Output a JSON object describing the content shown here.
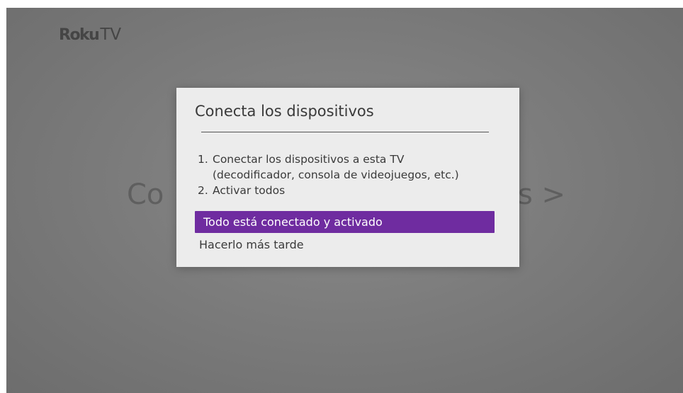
{
  "brand": {
    "roku": "Roku",
    "tv": "TV"
  },
  "background": {
    "left_text": "Co",
    "right_text": "s >"
  },
  "dialog": {
    "title": "Conecta los dispositivos",
    "steps": [
      {
        "num": "1.",
        "lines": [
          "Conectar los dispositivos a esta TV",
          "(decodificador, consola de videojuegos, etc.)"
        ]
      },
      {
        "num": "2.",
        "lines": [
          "Activar todos"
        ]
      }
    ],
    "options": [
      {
        "label": "Todo está conectado y activado",
        "selected": true
      },
      {
        "label": "Hacerlo más tarde",
        "selected": false
      }
    ]
  },
  "colors": {
    "accent": "#6f2ca0",
    "dialog_bg": "#ececec",
    "screen_bg": "#7c7c7c"
  }
}
